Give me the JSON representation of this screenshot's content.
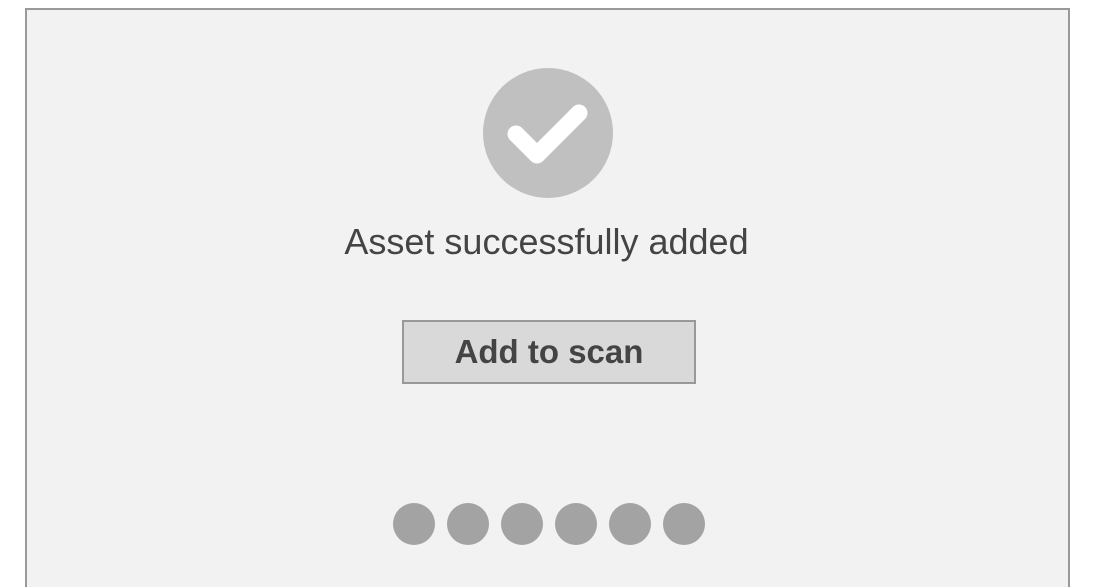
{
  "dialog": {
    "icon": "checkmark-circle-icon",
    "message": "Asset successfully added",
    "primary_button_label": "Add to scan"
  },
  "pager": {
    "dot_count": 6
  },
  "colors": {
    "background": "#f2f2f2",
    "border": "#999999",
    "icon_circle": "#c0c0c0",
    "text": "#444444",
    "button_bg": "#d9d9d9",
    "dot": "#a3a3a3"
  }
}
